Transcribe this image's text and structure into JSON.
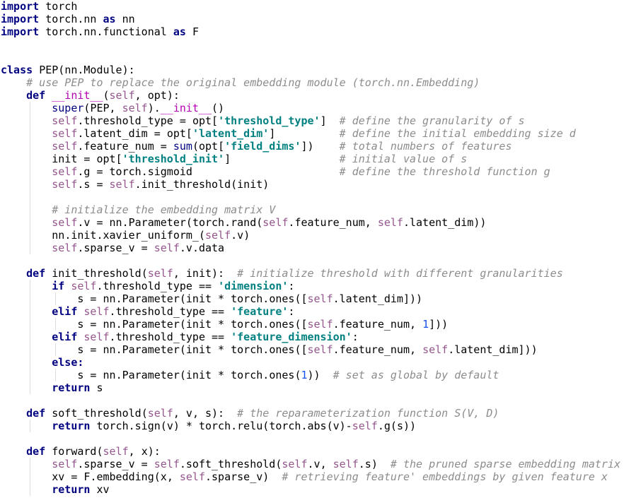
{
  "editor": {
    "language": "python",
    "colors": {
      "keyword": "#000080",
      "self": "#94558d",
      "string": "#008080",
      "comment": "#8c8c8c",
      "magic": "#b200b2",
      "number": "#1750eb"
    },
    "lines": [
      "import torch",
      "import torch.nn as nn",
      "import torch.nn.functional as F",
      "",
      "",
      "class PEP(nn.Module):",
      "    # use PEP to replace the original embedding module (torch.nn.Embedding)",
      "    def __init__(self, opt):",
      "        super(PEP, self).__init__()",
      "        self.threshold_type = opt['threshold_type']  # define the granularity of s",
      "        self.latent_dim = opt['latent_dim']          # define the initial embedding size d",
      "        self.feature_num = sum(opt['field_dims'])    # total numbers of features",
      "        init = opt['threshold_init']                 # initial value of s",
      "        self.g = torch.sigmoid                       # define the threshold function g",
      "        self.s = self.init_threshold(init)",
      "        ",
      "        # initialize the embedding matrix V",
      "        self.v = nn.Parameter(torch.rand(self.feature_num, self.latent_dim))",
      "        nn.init.xavier_uniform_(self.v)",
      "        self.sparse_v = self.v.data",
      "",
      "    def init_threshold(self, init):  # initialize threshold with different granularities",
      "        if self.threshold_type == 'dimension':",
      "            s = nn.Parameter(init * torch.ones([self.latent_dim]))",
      "        elif self.threshold_type == 'feature':",
      "            s = nn.Parameter(init * torch.ones([self.feature_num, 1]))",
      "        elif self.threshold_type == 'feature_dimension':",
      "            s = nn.Parameter(init * torch.ones([self.feature_num, self.latent_dim]))",
      "        else:",
      "            s = nn.Parameter(init * torch.ones(1))  # set as global by default",
      "        return s",
      "",
      "    def soft_threshold(self, v, s):  # the reparameterization function S(V, D)",
      "        return torch.sign(v) * torch.relu(torch.abs(v)-self.g(s))",
      "",
      "    def forward(self, x):",
      "        self.sparse_v = self.soft_threshold(self.v, self.s)  # the pruned sparse embedding matrix",
      "        xv = F.embedding(x, self.sparse_v)  # retrieving feature' embeddings by given feature x",
      "        return xv"
    ],
    "guides": [
      0,
      0,
      0,
      0,
      0,
      0,
      0,
      0,
      1,
      1,
      1,
      1,
      1,
      1,
      1,
      1,
      1,
      1,
      1,
      1,
      0,
      0,
      1,
      2,
      1,
      2,
      1,
      2,
      1,
      2,
      1,
      0,
      0,
      1,
      0,
      0,
      1,
      1,
      1
    ]
  }
}
